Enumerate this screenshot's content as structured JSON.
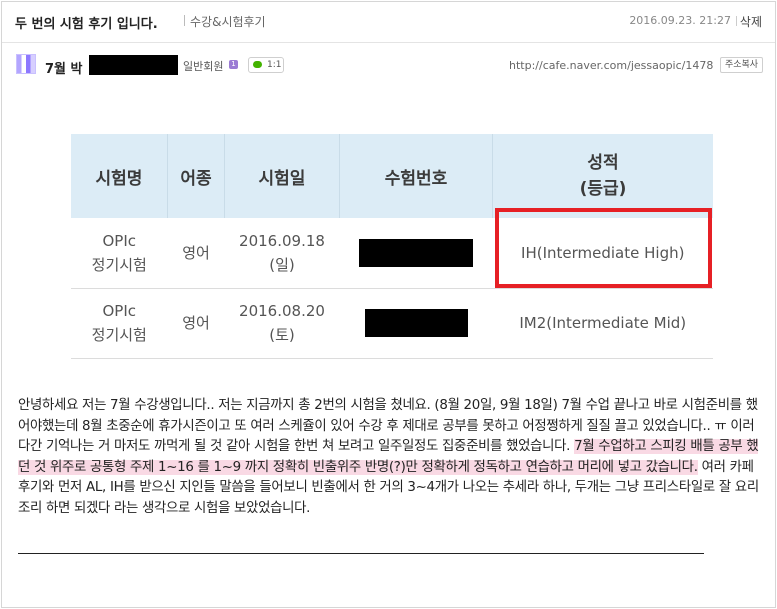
{
  "post": {
    "title": "두 번의 시험 후기 입니다.",
    "category": "수강&시험후기",
    "date": "2016.09.23. 21:27",
    "delete_label": "삭제"
  },
  "author": {
    "name": "7월 박",
    "grade": "일반회원",
    "level": "1",
    "comments": "1:1",
    "url": "http://cafe.naver.com/jessaopic/1478",
    "copy_label": "주소복사"
  },
  "table": {
    "headers": [
      "시험명",
      "어종",
      "시험일",
      "수험번호",
      "성적\n(등급)"
    ],
    "rows": [
      {
        "exam": "OPIc\n정기시험",
        "lang": "영어",
        "date": "2016.09.18\n(일)",
        "grade": "IH(Intermediate High)"
      },
      {
        "exam": "OPIc\n정기시험",
        "lang": "영어",
        "date": "2016.08.20\n(토)",
        "grade": "IM2(Intermediate Mid)"
      }
    ]
  },
  "body": {
    "part1": "안녕하세요 저는 7월 수강생입니다.. 저는 지금까지 총 2번의 시험을 쳤네요. (8월 20일, 9월 18일) 7월 수업 끝나고 바로 시험준비를 했어야했는데 8월 초중순에 휴가시즌이고 또 여러 스케쥴이 있어 수강 후 제대로  공부를 못하고 어정쩡하게 질질 끌고 있었습니다.. ㅠ 이러다간 기억나는 거 마저도 까먹게 될 것 같아 시험을 한번 쳐 보려고 일주일정도 집중준비를 했었습니다. ",
    "highlight": "7월 수업하고 스피킹 배틀 공부 했던 것 위주로 공통형 주제 1~16 를 1~9 까지 정확히 빈출위주 반명(?)만 정확하게 정독하고 연습하고 머리에 넣고 갔습니다.",
    "part2": " 여러 카페후기와 먼저 AL, IH를 받으신 지인들 말씀을 들어보니 빈출에서 한 거의 3~4개가 나오는 추세라 하나, 두개는 그냥 프리스타일로 잘 요리조리 하면 되겠다 라는 생각으로 시험을 보았었습니다."
  }
}
